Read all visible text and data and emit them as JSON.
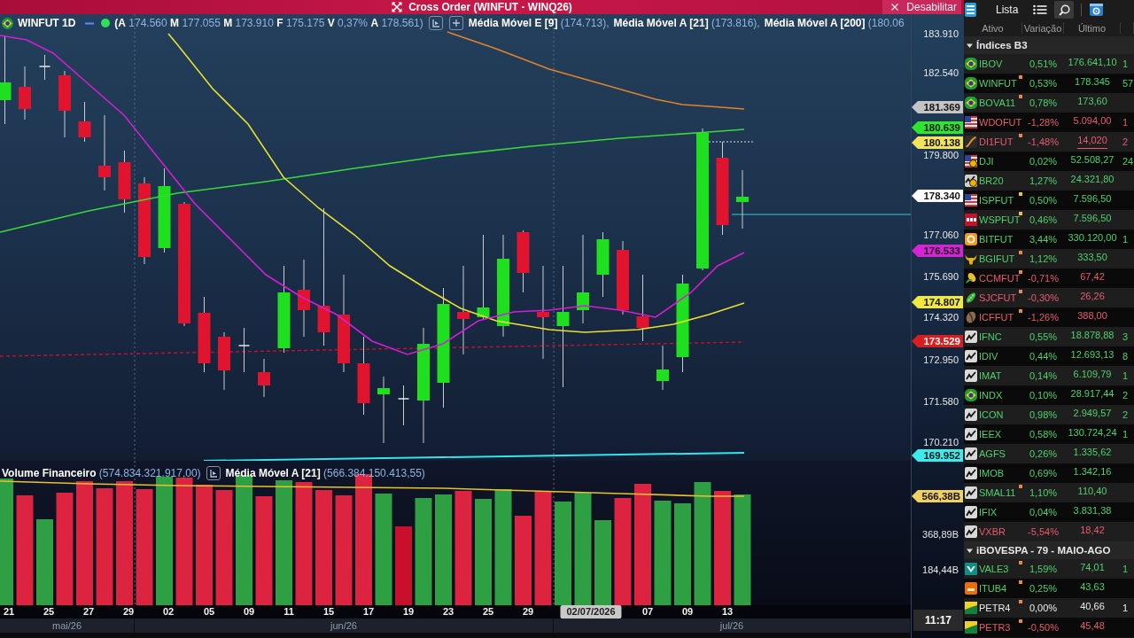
{
  "title_bar": {
    "title": "Cross Order (WINFUT - WINQ26)",
    "action": "Desabilitar"
  },
  "chart": {
    "legend": {
      "symbol": "WINFUT 1D",
      "live": true,
      "ohlc": [
        {
          "label": "(A",
          "value": "174.560"
        },
        {
          "label": "M",
          "value": "177.055"
        },
        {
          "label": "M",
          "value": "173.910"
        },
        {
          "label": "F",
          "value": "175.175"
        },
        {
          "label": "V",
          "value": "0,37%"
        },
        {
          "label": "A",
          "value": "178.561)"
        }
      ],
      "indicators": [
        {
          "name": "Média Móvel E [9]",
          "value": "(174.713),"
        },
        {
          "name": "Média Móvel A [21]",
          "value": "(173.816),"
        },
        {
          "name": "Média Móvel A [200]",
          "value": "(180.06"
        }
      ]
    },
    "volume_legend": {
      "name": "Volume Financeiro",
      "value": "(574.834.321.917,00)",
      "indicator": "Média Móvel A [21]",
      "indicator_value": "(566.384.150.413,55)"
    },
    "price_axis": {
      "labels": [
        "183.910",
        "182.540",
        "179.800",
        "177.060",
        "175.690",
        "174.320",
        "172.950",
        "171.580",
        "170.210",
        "368,89B",
        "184,44B"
      ],
      "tags": [
        {
          "value": "181.369",
          "color": "#c4c4c4"
        },
        {
          "value": "180.639",
          "color": "#2ee62e"
        },
        {
          "value": "180.138",
          "color": "#f2e35a"
        },
        {
          "value": "178.340",
          "color": "#ffffff"
        },
        {
          "value": "176.533",
          "color": "#d424d4"
        },
        {
          "value": "174.807",
          "color": "#f2e640"
        },
        {
          "value": "173.529",
          "color": "#d81e1e"
        },
        {
          "value": "169.952",
          "color": "#3cecec"
        },
        {
          "value": "566,38B",
          "color": "#f0d060"
        }
      ],
      "time": "11:17"
    },
    "date_axis": {
      "dates": [
        {
          "label": "21",
          "selected": false
        },
        {
          "label": "25",
          "selected": false
        },
        {
          "label": "27",
          "selected": false
        },
        {
          "label": "29",
          "selected": false
        },
        {
          "label": "02",
          "selected": false
        },
        {
          "label": "05",
          "selected": false
        },
        {
          "label": "09",
          "selected": false
        },
        {
          "label": "11",
          "selected": false
        },
        {
          "label": "15",
          "selected": false
        },
        {
          "label": "17",
          "selected": false
        },
        {
          "label": "19",
          "selected": false
        },
        {
          "label": "23",
          "selected": false
        },
        {
          "label": "25",
          "selected": false
        },
        {
          "label": "29",
          "selected": false
        },
        {
          "label": "02/07/2026",
          "selected": true
        },
        {
          "label": "07",
          "selected": false
        },
        {
          "label": "09",
          "selected": false
        },
        {
          "label": "13",
          "selected": false
        }
      ],
      "months": [
        "mai/26",
        "jun/26",
        "jul/26"
      ]
    }
  },
  "watchlist": {
    "title": "Lista",
    "columns": [
      "Ativo",
      "Variação",
      "Último"
    ],
    "groups": [
      {
        "title": "Índices B3",
        "expanded": true,
        "rows": [
          {
            "kind": "br",
            "symbol": "IBOV",
            "change": "0,51%",
            "last": "176.641,10",
            "column_4": "1",
            "positive": true,
            "negative": false,
            "underlined": false
          },
          {
            "kind": "br",
            "symbol": "WINFUT",
            "change": "0,53%",
            "last": "178.345",
            "column_4": "57",
            "positive": true,
            "negative": false,
            "underlined": false,
            "color": "#e8894a"
          },
          {
            "kind": "br",
            "symbol": "BOVA11",
            "change": "0,78%",
            "last": "173,60",
            "positive": true,
            "negative": false,
            "underlined": false,
            "color": "#e8894a"
          },
          {
            "kind": "us",
            "symbol": "WDOFUT",
            "change": "-1,28%",
            "last": "5.094,00",
            "column_4": "1",
            "positive": false,
            "negative": true,
            "underlined": false
          },
          {
            "kind": "rate",
            "symbol": "DI1FUT",
            "change": "-1,48%",
            "last": "14,020",
            "column_4": "2",
            "positive": false,
            "negative": true,
            "underlined": true,
            "color": "#e8894a"
          },
          {
            "kind": "dow",
            "symbol": "DJI",
            "change": "0,02%",
            "last": "52.508,27",
            "column_4": "24",
            "positive": true,
            "negative": false,
            "underlined": false
          },
          {
            "kind": "emerging",
            "symbol": "BR20",
            "change": "1,27%",
            "last": "24.321,80",
            "positive": true,
            "negative": false,
            "underlined": false
          },
          {
            "kind": "us",
            "symbol": "ISPFUT",
            "change": "0,50%",
            "last": "7.596,50",
            "positive": true,
            "negative": false,
            "underlined": false,
            "color": "#e8c04a"
          },
          {
            "kind": "spx",
            "symbol": "WSPFUT",
            "change": "0,46%",
            "last": "7.596,50",
            "positive": true,
            "negative": false,
            "underlined": false,
            "color": "#e8c04a"
          },
          {
            "kind": "crypto",
            "symbol": "BITFUT",
            "change": "3,44%",
            "last": "330.120,00",
            "column_4": "1",
            "positive": true,
            "negative": false,
            "underlined": false
          },
          {
            "kind": "cattle",
            "symbol": "BGIFUT",
            "change": "1,12%",
            "last": "333,50",
            "positive": true,
            "negative": false,
            "underlined": false,
            "color": "#e8894a"
          },
          {
            "kind": "corn",
            "symbol": "CCMFUT",
            "change": "-0,71%",
            "last": "67,42",
            "positive": false,
            "negative": true,
            "underlined": false,
            "color": "#e8894a"
          },
          {
            "kind": "soy",
            "symbol": "SJCFUT",
            "change": "-0,30%",
            "last": "26,26",
            "positive": false,
            "negative": true,
            "underlined": false,
            "color": "#e8894a"
          },
          {
            "kind": "coffee",
            "symbol": "ICFFUT",
            "change": "-1,26%",
            "last": "388,00",
            "positive": false,
            "negative": true,
            "underlined": false,
            "color": "#e8894a"
          },
          {
            "kind": "b3",
            "symbol": "IFNC",
            "change": "0,55%",
            "last": "18.878,88",
            "column_4": "3",
            "positive": true,
            "negative": false,
            "underlined": false
          },
          {
            "kind": "b3",
            "symbol": "IDIV",
            "change": "0,44%",
            "last": "12.693,13",
            "column_4": "8",
            "positive": true,
            "negative": false,
            "underlined": false
          },
          {
            "kind": "b3",
            "symbol": "IMAT",
            "change": "0,14%",
            "last": "6.109,79",
            "column_4": "1",
            "positive": true,
            "negative": false,
            "underlined": false
          },
          {
            "kind": "br",
            "symbol": "INDX",
            "change": "0,10%",
            "last": "28.917,44",
            "column_4": "2",
            "positive": true,
            "negative": false,
            "underlined": false
          },
          {
            "kind": "b3",
            "symbol": "ICON",
            "change": "0,98%",
            "last": "2.949,57",
            "column_4": "2",
            "positive": true,
            "negative": false,
            "underlined": false
          },
          {
            "kind": "b3",
            "symbol": "IEEX",
            "change": "0,58%",
            "last": "130.724,24",
            "column_4": "1",
            "positive": true,
            "negative": false,
            "underlined": false
          },
          {
            "kind": "b3",
            "symbol": "AGFS",
            "change": "0,26%",
            "last": "1.335,62",
            "positive": true,
            "negative": false,
            "underlined": false
          },
          {
            "kind": "b3",
            "symbol": "IMOB",
            "change": "0,69%",
            "last": "1.342,16",
            "positive": true,
            "negative": false,
            "underlined": false
          },
          {
            "kind": "b3",
            "symbol": "SMAL11",
            "change": "1,10%",
            "last": "110,40",
            "positive": true,
            "negative": false,
            "underlined": false,
            "color": "#e8894a"
          },
          {
            "kind": "b3",
            "symbol": "IFIX",
            "change": "0,04%",
            "last": "3.831,38",
            "positive": true,
            "negative": false,
            "underlined": false
          },
          {
            "kind": "b3",
            "symbol": "VXBR",
            "change": "-5,54%",
            "last": "18,42",
            "positive": false,
            "negative": true,
            "underlined": false
          }
        ]
      },
      {
        "title": "iBOVESPA - 79 - MAIO-AGO",
        "expanded": true,
        "rows": [
          {
            "kind": "vale",
            "symbol": "VALE3",
            "change": "1,59%",
            "last": "74,01",
            "column_4": "1",
            "positive": true,
            "negative": false,
            "underlined": false,
            "color": "#e8894a"
          },
          {
            "kind": "itau",
            "symbol": "ITUB4",
            "change": "0,25%",
            "last": "43,63",
            "positive": true,
            "negative": false,
            "underlined": false,
            "color": "#e8894a"
          },
          {
            "kind": "petro",
            "symbol": "PETR4",
            "change": "0,00%",
            "last": "40,66",
            "column_4": "1",
            "positive": false,
            "negative": false,
            "underlined": false,
            "color": "#e8894a"
          },
          {
            "kind": "petro",
            "symbol": "PETR3",
            "change": "-0,50%",
            "last": "45,48",
            "positive": false,
            "negative": true,
            "underlined": false,
            "color": "#e8894a"
          }
        ]
      }
    ]
  }
}
